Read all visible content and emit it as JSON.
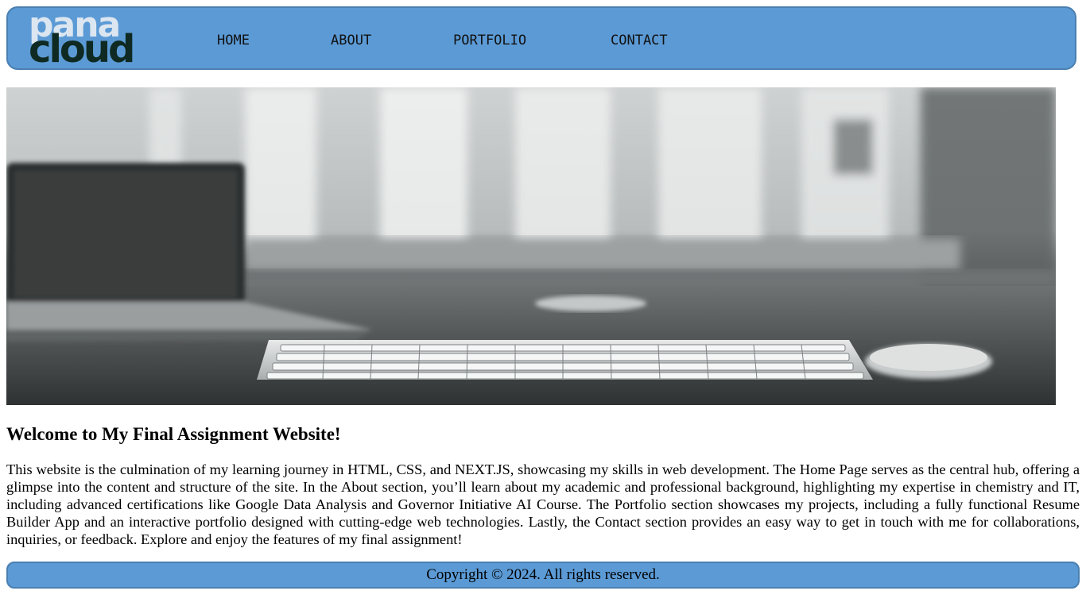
{
  "header": {
    "logo": {
      "line1": "pana",
      "line2": "cloud"
    },
    "nav": [
      {
        "label": "HOME"
      },
      {
        "label": "ABOUT"
      },
      {
        "label": "PORTFOLIO"
      },
      {
        "label": "CONTACT"
      }
    ]
  },
  "hero": {
    "icon": "desk-workspace-photo"
  },
  "main": {
    "heading": "Welcome to My Final Assignment Website!",
    "paragraph": "This website is the culmination of my learning journey in HTML, CSS, and NEXT.JS, showcasing my skills in web development. The Home Page serves as the central hub, offering a glimpse into the content and structure of the site. In the About section, you’ll learn about my academic and professional background, highlighting my expertise in chemistry and IT, including advanced certifications like Google Data Analysis and Governor Initiative AI Course. The Portfolio section showcases my projects, including a fully functional Resume Builder App and an interactive portfolio designed with cutting-edge web technologies. Lastly, the Contact section provides an easy way to get in touch with me for collaborations, inquiries, or feedback. Explore and enjoy the features of my final assignment!"
  },
  "footer": {
    "copyright": "Copyright © 2024. All rights reserved."
  },
  "colors": {
    "header_bg": "#5b9ad5",
    "header_border": "#4a7fb0",
    "logo_light": "#dce6f0",
    "logo_dark": "#0f2a22"
  }
}
